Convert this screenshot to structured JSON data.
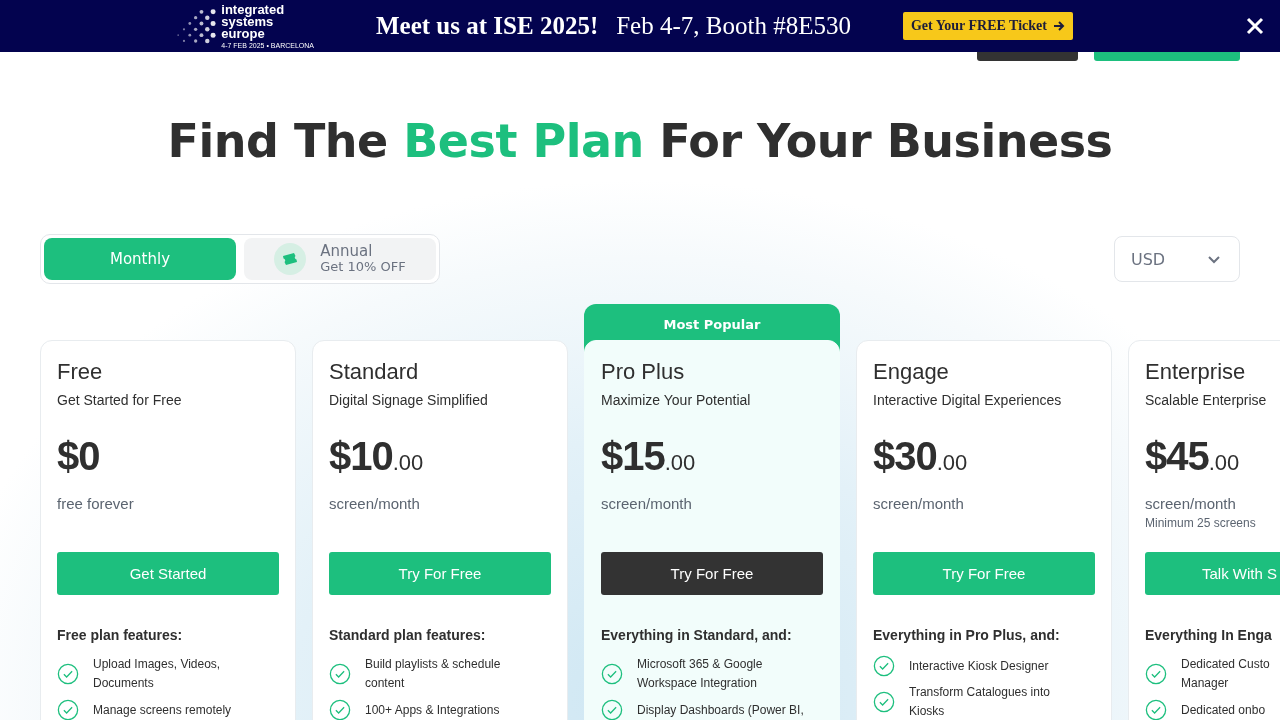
{
  "banner": {
    "logo_lines": [
      "integrated",
      "systems",
      "europe"
    ],
    "logo_date": "4-7 FEB 2025 • BARCELONA",
    "headline": "Meet us at ISE 2025!",
    "details": "Feb 4-7, Booth #8E530",
    "cta": "Get Your FREE Ticket"
  },
  "title": [
    {
      "text": "Find The ",
      "highlight": false
    },
    {
      "text": "Best Plan",
      "highlight": true
    },
    {
      "text": " For Your Business",
      "highlight": false
    }
  ],
  "billing": [
    {
      "label": "Monthly",
      "selected": true
    },
    {
      "label": "Annual",
      "note": "Get 10% OFF",
      "selected": false
    }
  ],
  "currency": "USD",
  "plans": [
    {
      "name": "Free",
      "tagline": "Get Started for Free",
      "price": "$0",
      "period": "free forever",
      "button": "Get Started",
      "featured": false,
      "features_heading": "Free plan features:",
      "features": [
        "Upload Images, Videos, Documents",
        "Manage screens remotely"
      ]
    },
    {
      "name": "Standard",
      "tagline": "Digital Signage Simplified",
      "price": "$10",
      "cents": ".00",
      "period": "screen/month",
      "button": "Try For Free",
      "featured": false,
      "features_heading": "Standard plan features:",
      "features": [
        "Build playlists & schedule content",
        "100+ Apps & Integrations"
      ]
    },
    {
      "name": "Pro Plus",
      "tagline": "Maximize Your Potential",
      "price": "$15",
      "cents": ".00",
      "period": "screen/month",
      "button": "Try For Free",
      "featured": true,
      "badge": "Most Popular",
      "features_heading": "Everything in Standard, and:",
      "features": [
        "Microsoft 365 & Google Workspace Integration",
        "Display Dashboards (Power BI,"
      ]
    },
    {
      "name": "Engage",
      "tagline": "Interactive Digital Experiences",
      "price": "$30",
      "cents": ".00",
      "period": "screen/month",
      "button": "Try For Free",
      "featured": false,
      "features_heading": "Everything in Pro Plus, and:",
      "features": [
        "Interactive Kiosk Designer",
        "Transform Catalogues into Kiosks"
      ]
    },
    {
      "name": "Enterprise",
      "tagline": "Scalable Enterprise",
      "price": "$45",
      "cents": ".00",
      "period": "screen/month",
      "minimum": "Minimum 25 screens",
      "button": "Talk With S",
      "featured": false,
      "features_heading": "Everything In Enga",
      "features": [
        "Dedicated Custo Manager",
        "Dedicated onbo"
      ]
    }
  ]
}
